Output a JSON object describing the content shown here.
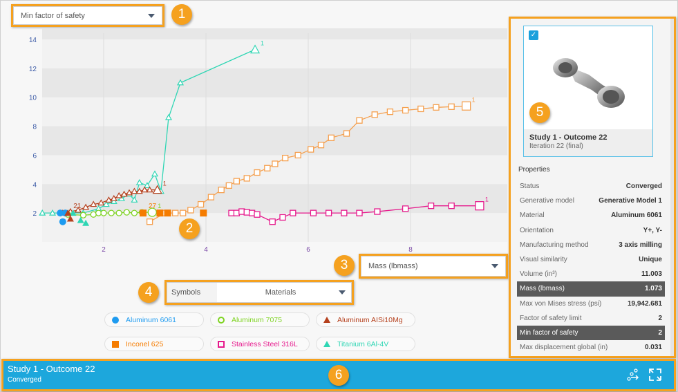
{
  "y_metric_dropdown": {
    "value": "Min factor of safety"
  },
  "x_metric_dropdown": {
    "value": "Mass (lbmass)"
  },
  "symbols_dropdown": {
    "label": "Symbols",
    "value": "Materials"
  },
  "callouts": [
    "1",
    "2",
    "3",
    "4",
    "5",
    "6"
  ],
  "legend": [
    {
      "label": "Aluminum 6061",
      "color": "#1e9bf0",
      "shape": "filled-circle"
    },
    {
      "label": "Aluminum 7075",
      "color": "#7ed321",
      "shape": "hollow-circle"
    },
    {
      "label": "Aluminum AISi10Mg",
      "color": "#b5401d",
      "shape": "filled-triangle"
    },
    {
      "label": "Inconel 625",
      "color": "#f57c00",
      "shape": "filled-square"
    },
    {
      "label": "Stainless Steel 316L",
      "color": "#e6198c",
      "shape": "hollow-square"
    },
    {
      "label": "Titanium 6Al-4V",
      "color": "#2fd6b4",
      "shape": "filled-triangle"
    }
  ],
  "chart_data": {
    "type": "scatter",
    "xlabel": "Mass (lbmass)",
    "ylabel": "Min factor of safety",
    "xlim": [
      0,
      9.1
    ],
    "ylim": [
      0,
      14.3
    ],
    "xticks": [
      "2",
      "4",
      "6",
      "8"
    ],
    "yticks": [
      "2",
      "4",
      "6",
      "8",
      "10",
      "12",
      "14"
    ],
    "grid": true,
    "series": [
      {
        "name": "Titanium 6Al-4V (trend)",
        "color": "#2fd6b4",
        "shape": "hollow-triangle",
        "line": true,
        "end_label": "1",
        "x": [
          0.8,
          1.0,
          1.3,
          1.6,
          1.9,
          2.05,
          2.2,
          2.35,
          2.5,
          2.6,
          2.7,
          2.85,
          3.0,
          3.12,
          3.27,
          3.5,
          4.96
        ],
        "y": [
          2.0,
          2.0,
          2.0,
          2.0,
          2.3,
          2.6,
          2.8,
          3.0,
          3.3,
          2.9,
          4.1,
          3.9,
          4.7,
          3.5,
          8.6,
          11.0,
          13.3
        ]
      },
      {
        "name": "Aluminum AISi10Mg (trend)",
        "color": "#b5401d",
        "shape": "hollow-triangle",
        "line": true,
        "end_label": "1",
        "x": [
          1.2,
          1.35,
          1.5,
          1.65,
          1.8,
          1.95,
          2.1,
          2.2,
          2.3,
          2.4,
          2.5,
          2.6,
          2.7,
          2.8,
          2.9,
          3.05
        ],
        "y": [
          2.0,
          2.1,
          2.2,
          2.4,
          2.6,
          2.7,
          2.9,
          3.0,
          3.2,
          3.3,
          3.4,
          3.5,
          3.5,
          3.6,
          3.6,
          3.6
        ]
      },
      {
        "name": "Aluminum 7075 (trend)",
        "color": "#7ed321",
        "shape": "hollow-circle",
        "line": true,
        "end_label": "1",
        "x": [
          1.3,
          1.6,
          1.8,
          1.9,
          2.0,
          2.15,
          2.3,
          2.45,
          2.6,
          2.75,
          2.95
        ],
        "y": [
          1.9,
          1.85,
          1.9,
          2.0,
          2.0,
          2.0,
          2.0,
          2.05,
          2.0,
          2.05,
          2.05
        ]
      },
      {
        "name": "Inconel 625 (trend)",
        "color": "#f5a04f",
        "shape": "hollow-square",
        "line": true,
        "end_label": "1",
        "x": [
          2.9,
          3.2,
          3.4,
          3.55,
          3.7,
          3.9,
          4.1,
          4.3,
          4.45,
          4.6,
          4.8,
          5.0,
          5.2,
          5.35,
          5.55,
          5.8,
          6.05,
          6.25,
          6.45,
          6.75,
          7.0,
          7.3,
          7.6,
          7.9,
          8.2,
          8.5,
          8.8,
          9.09
        ],
        "y": [
          1.4,
          2.0,
          2.0,
          2.0,
          2.2,
          2.6,
          3.1,
          3.6,
          3.9,
          4.2,
          4.4,
          4.8,
          5.1,
          5.4,
          5.8,
          6.0,
          6.4,
          6.7,
          7.2,
          7.5,
          8.4,
          8.8,
          9.0,
          9.1,
          9.2,
          9.3,
          9.35,
          9.4
        ]
      },
      {
        "name": "Stainless Steel 316L (trend)",
        "color": "#e6198c",
        "shape": "hollow-square",
        "line": true,
        "end_label": "1",
        "x": [
          4.5,
          4.6,
          4.7,
          4.8,
          4.9,
          5.0,
          5.3,
          5.5,
          5.7,
          6.1,
          6.4,
          6.7,
          7.0,
          7.35,
          7.9,
          8.4,
          8.8,
          9.35
        ],
        "y": [
          2.0,
          2.0,
          2.1,
          2.05,
          2.0,
          1.9,
          1.4,
          1.7,
          2.0,
          2.0,
          2.0,
          2.0,
          2.0,
          2.1,
          2.3,
          2.5,
          2.5,
          2.5
        ]
      },
      {
        "name": "Aluminum 6061",
        "color": "#1e9bf0",
        "shape": "filled-circle",
        "line": false,
        "x": [
          1.15,
          1.25,
          1.2
        ],
        "y": [
          2.0,
          2.0,
          1.4
        ]
      },
      {
        "name": "Inconel 625",
        "color": "#f57c00",
        "shape": "filled-square",
        "line": false,
        "point_label": "27",
        "x": [
          2.77,
          3.1,
          3.25,
          3.95
        ],
        "y": [
          2.0,
          2.0,
          2.0,
          2.0
        ]
      },
      {
        "name": "Titanium 6Al-4V",
        "color": "#2fd6b4",
        "shape": "filled-triangle",
        "line": false,
        "x": [
          1.4,
          1.55,
          1.65
        ],
        "y": [
          2.0,
          1.5,
          1.3
        ]
      },
      {
        "name": "Aluminum AISi10Mg",
        "color": "#b5401d",
        "shape": "filled-triangle",
        "line": false,
        "point_label": "21",
        "x": [
          1.3,
          1.35
        ],
        "y": [
          2.0,
          1.6
        ]
      }
    ]
  },
  "selected_card": {
    "checked": true,
    "title": "Study 1 - Outcome 22",
    "subtitle": "Iteration 22 (final)"
  },
  "properties": {
    "heading": "Properties",
    "rows": [
      {
        "key": "Status",
        "value": "Converged",
        "highlight": false
      },
      {
        "key": "Generative model",
        "value": "Generative Model 1",
        "highlight": false
      },
      {
        "key": "Material",
        "value": "Aluminum 6061",
        "highlight": false
      },
      {
        "key": "Orientation",
        "value": "Y+, Y-",
        "highlight": false
      },
      {
        "key": "Manufacturing method",
        "value": "3 axis milling",
        "highlight": false
      },
      {
        "key": "Visual similarity",
        "value": "Unique",
        "highlight": false
      },
      {
        "key": "Volume (in³)",
        "value": "11.003",
        "highlight": false
      },
      {
        "key": "Mass (lbmass)",
        "value": "1.073",
        "highlight": true
      },
      {
        "key": "Max von Mises stress (psi)",
        "value": "19,942.681",
        "highlight": false
      },
      {
        "key": "Factor of safety limit",
        "value": "2",
        "highlight": false
      },
      {
        "key": "Min factor of safety",
        "value": "2",
        "highlight": true
      },
      {
        "key": "Max displacement global (in)",
        "value": "0.031",
        "highlight": false
      }
    ]
  },
  "bottom_bar": {
    "title": "Study 1 - Outcome 22",
    "status": "Converged",
    "icons": [
      "compare-icon",
      "expand-icon"
    ]
  }
}
